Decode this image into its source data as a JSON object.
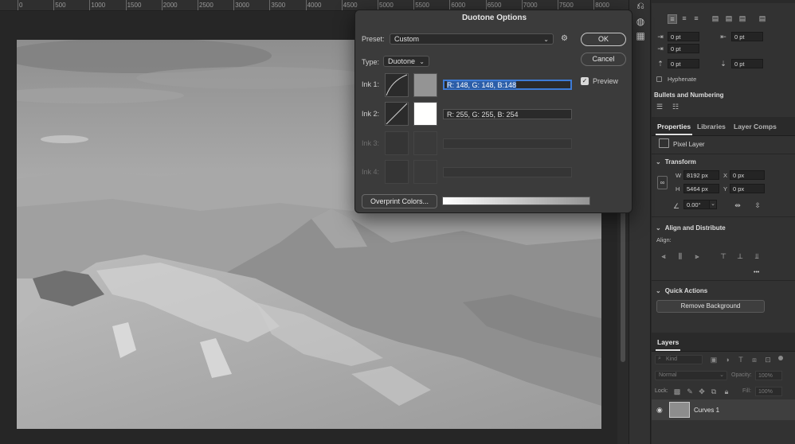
{
  "ruler": {
    "ticks": [
      "0",
      "500",
      "1000",
      "1500",
      "2000",
      "2500",
      "3000",
      "3500",
      "4000",
      "4500",
      "5000",
      "5500",
      "6000",
      "6500",
      "7000",
      "7500",
      "8000"
    ]
  },
  "dialog": {
    "title": "Duotone Options",
    "preset_label": "Preset:",
    "preset_value": "Custom",
    "type_label": "Type:",
    "type_value": "Duotone",
    "inks": [
      {
        "label": "Ink 1:",
        "value": "R: 148, G: 148, B:148",
        "swatch": "#949494",
        "enabled": true,
        "selected": true
      },
      {
        "label": "Ink 2:",
        "value": "R: 255, G: 255, B: 254",
        "swatch": "#fffffe",
        "enabled": true,
        "selected": false
      },
      {
        "label": "Ink 3:",
        "value": "",
        "swatch": "#3a3a3a",
        "enabled": false,
        "selected": false
      },
      {
        "label": "Ink 4:",
        "value": "",
        "swatch": "#3a3a3a",
        "enabled": false,
        "selected": false
      }
    ],
    "ok_label": "OK",
    "cancel_label": "Cancel",
    "preview_label": "Preview",
    "preview_checked": true,
    "overprint_label": "Overprint Colors..."
  },
  "paragraph_panel": {
    "fields": [
      "0 pt",
      "0 pt",
      "0 pt",
      "0 pt",
      "0 pt"
    ],
    "hyphenate_label": "Hyphenate",
    "bullets_title": "Bullets and Numbering"
  },
  "properties_panel": {
    "tabs": [
      "Properties",
      "Libraries",
      "Layer Comps"
    ],
    "layer_kind": "Pixel Layer",
    "transform_title": "Transform",
    "w_label": "W",
    "w_value": "8192 px",
    "h_label": "H",
    "h_value": "5464 px",
    "x_label": "X",
    "x_value": "0 px",
    "y_label": "Y",
    "y_value": "0 px",
    "angle_value": "0.00°",
    "align_title": "Align and Distribute",
    "align_label": "Align:",
    "more_label": "•••",
    "quick_actions_title": "Quick Actions",
    "remove_bg_label": "Remove Background"
  },
  "layers_panel": {
    "title": "Layers",
    "kind_placeholder": "Kind",
    "blend_mode": "Normal",
    "opacity_label": "Opacity:",
    "opacity_value": "100%",
    "lock_label": "Lock:",
    "fill_label": "Fill:",
    "fill_value": "100%",
    "layers": [
      {
        "name": "Curves 1",
        "visible": true
      }
    ]
  },
  "colors": {
    "accent": "#3d7bd6",
    "dialog_bg": "#3b3b3b",
    "panel_bg": "#323232"
  }
}
